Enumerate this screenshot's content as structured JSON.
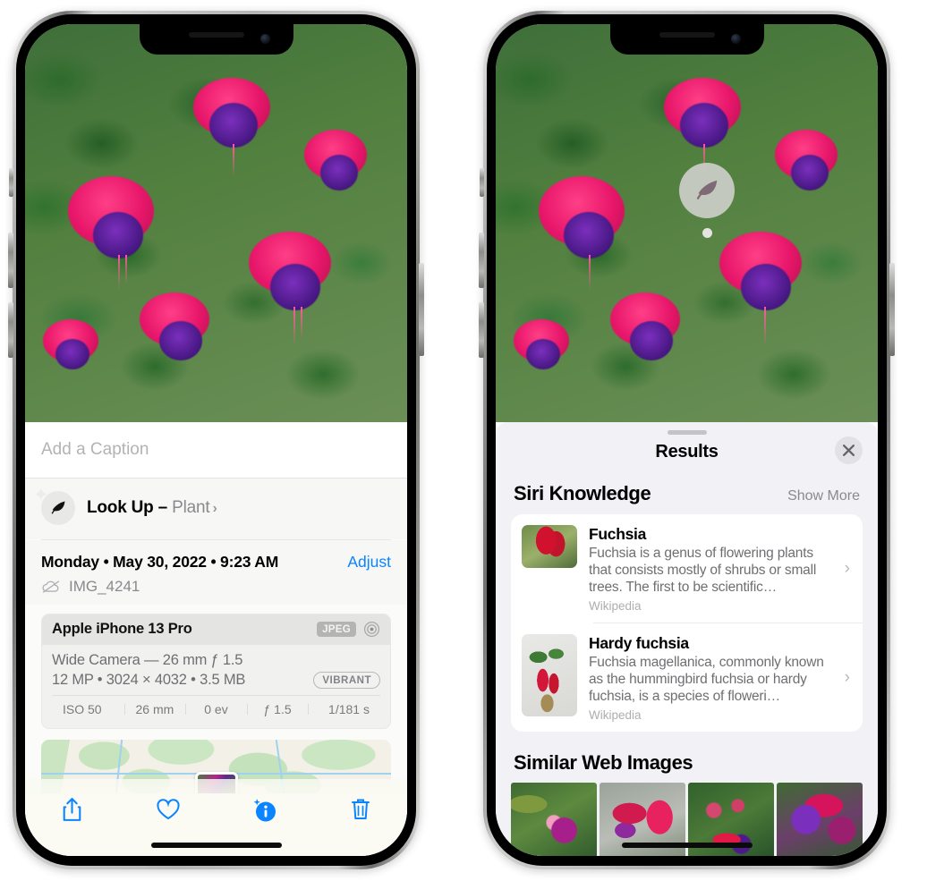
{
  "left_phone": {
    "photo": {
      "alt_name": "fuchsia-flowers-photo"
    },
    "caption_field": {
      "placeholder": "Add a Caption",
      "value": ""
    },
    "lookup": {
      "label": "Look Up – ",
      "subject": "Plant",
      "chevron": "›",
      "icon": "leaf-icon",
      "sparkle": "✦"
    },
    "metadata": {
      "date_line": "Monday • May 30, 2022 • 9:23 AM",
      "adjust_label": "Adjust",
      "filename": "IMG_4241",
      "cloud_icon": "cloud-slash-icon"
    },
    "exif": {
      "device": "Apple iPhone 13 Pro",
      "format_badge": "JPEG",
      "aperture_icon": "aperture-icon",
      "lens_line": "Wide Camera — 26 mm ƒ 1.5",
      "size_line": "12 MP • 3024 × 4032 • 3.5 MB",
      "style_badge": "VIBRANT",
      "stats": [
        "ISO 50",
        "26 mm",
        "0 ev",
        "ƒ 1.5",
        "1/181 s"
      ]
    },
    "map": {
      "name": "location-map-preview",
      "pin": "photo-pin"
    },
    "toolbar": [
      {
        "name": "share-button",
        "icon": "share-icon"
      },
      {
        "name": "favorite-button",
        "icon": "heart-icon"
      },
      {
        "name": "info-button",
        "icon": "info-sparkle-icon"
      },
      {
        "name": "delete-button",
        "icon": "trash-icon"
      }
    ]
  },
  "right_phone": {
    "photo": {
      "alt_name": "fuchsia-flowers-photo"
    },
    "leaf_badge": {
      "icon": "leaf-icon",
      "name": "visual-look-up-badge"
    },
    "sheet": {
      "title": "Results",
      "close_icon": "close-icon",
      "grabber": "drag-handle"
    },
    "siri_knowledge": {
      "heading": "Siri Knowledge",
      "show_more": "Show More",
      "cards": [
        {
          "title": "Fuchsia",
          "description": "Fuchsia is a genus of flowering plants that consists mostly of shrubs or small trees. The first to be scientific…",
          "source": "Wikipedia",
          "chevron": "›",
          "thumb": "fuchsia-thumbnail"
        },
        {
          "title": "Hardy fuchsia",
          "description": "Fuchsia magellanica, commonly known as the hummingbird fuchsia or hardy fuchsia, is a species of floweri…",
          "source": "Wikipedia",
          "chevron": "›",
          "thumb": "hardy-fuchsia-thumbnail"
        }
      ]
    },
    "similar_web_images": {
      "heading": "Similar Web Images",
      "thumbnails": [
        "similar-image-1",
        "similar-image-2",
        "similar-image-3",
        "similar-image-4"
      ]
    }
  },
  "colors": {
    "accent_blue": "#0a84ff",
    "sheet_bg": "#f2f1f6",
    "card_bg": "#ffffff",
    "secondary_text": "#8a8a8e"
  }
}
